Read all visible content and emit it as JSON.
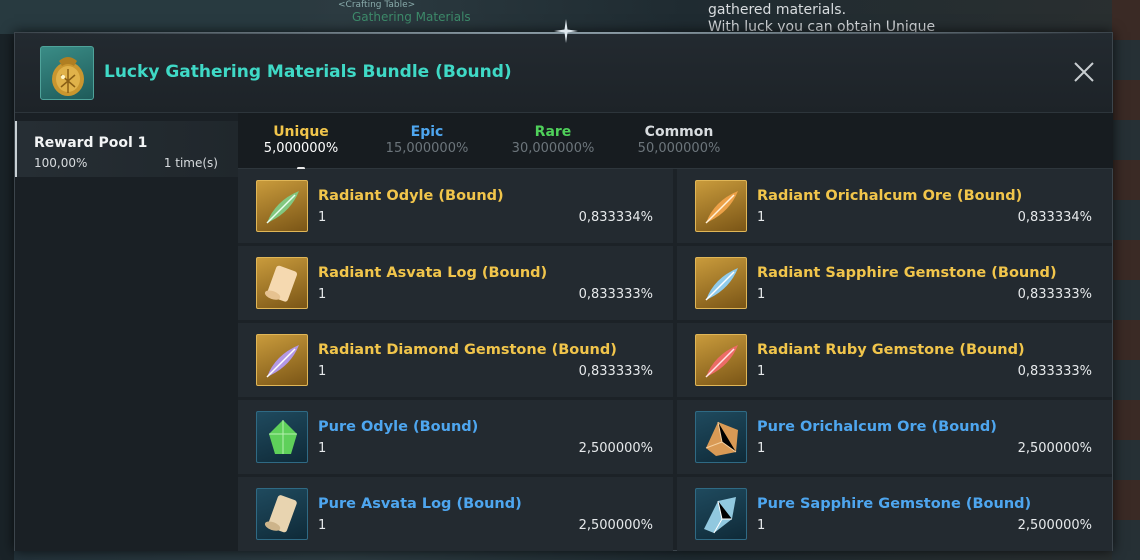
{
  "background": {
    "top_text_lines": "gathered materials.\nWith luck you can obtain Unique",
    "small_label": "<Crafting Table>",
    "small_label2": "Gathering Materials"
  },
  "dialog": {
    "title": "Lucky Gathering Materials Bundle (Bound)",
    "close_icon": "close-icon"
  },
  "sidebar": {
    "pool": {
      "name": "Reward Pool 1",
      "percent": "100,00%",
      "times": "1 time(s)"
    }
  },
  "tabs": [
    {
      "label": "Unique",
      "percent": "5,000000%",
      "color": "#f1c54b",
      "active": true
    },
    {
      "label": "Epic",
      "percent": "15,000000%",
      "color": "#4ea6ef",
      "active": false
    },
    {
      "label": "Rare",
      "percent": "30,000000%",
      "color": "#4fd05a",
      "active": false
    },
    {
      "label": "Common",
      "percent": "50,000000%",
      "color": "#d8dcdf",
      "active": false
    }
  ],
  "items": [
    {
      "name": "Radiant Odyle (Bound)",
      "qty": "1",
      "percent": "0,833334%",
      "rarity": "unique",
      "icon": "feather-icon",
      "accent": "#7fd08a"
    },
    {
      "name": "Radiant Orichalcum Ore (Bound)",
      "qty": "1",
      "percent": "0,833334%",
      "rarity": "unique",
      "icon": "feather-icon",
      "accent": "#f0a34a"
    },
    {
      "name": "Radiant Asvata Log (Bound)",
      "qty": "1",
      "percent": "0,833333%",
      "rarity": "unique",
      "icon": "scroll-icon",
      "accent": "#f5d9b0"
    },
    {
      "name": "Radiant Sapphire Gemstone (Bound)",
      "qty": "1",
      "percent": "0,833333%",
      "rarity": "unique",
      "icon": "feather-icon",
      "accent": "#8fd0f5"
    },
    {
      "name": "Radiant Diamond Gemstone (Bound)",
      "qty": "1",
      "percent": "0,833333%",
      "rarity": "unique",
      "icon": "feather-icon",
      "accent": "#b49af0"
    },
    {
      "name": "Radiant Ruby Gemstone (Bound)",
      "qty": "1",
      "percent": "0,833333%",
      "rarity": "unique",
      "icon": "feather-icon",
      "accent": "#f06a6a"
    },
    {
      "name": "Pure Odyle (Bound)",
      "qty": "1",
      "percent": "2,500000%",
      "rarity": "epic",
      "icon": "gem-icon",
      "accent": "#5fd05a"
    },
    {
      "name": "Pure Orichalcum Ore (Bound)",
      "qty": "1",
      "percent": "2,500000%",
      "rarity": "epic",
      "icon": "ore-icon",
      "accent": "#d99a55"
    },
    {
      "name": "Pure Asvata Log (Bound)",
      "qty": "1",
      "percent": "2,500000%",
      "rarity": "epic",
      "icon": "scroll-icon",
      "accent": "#e8d4b0"
    },
    {
      "name": "Pure Sapphire Gemstone (Bound)",
      "qty": "1",
      "percent": "2,500000%",
      "rarity": "epic",
      "icon": "crystal-icon",
      "accent": "#9fd8f0"
    }
  ]
}
